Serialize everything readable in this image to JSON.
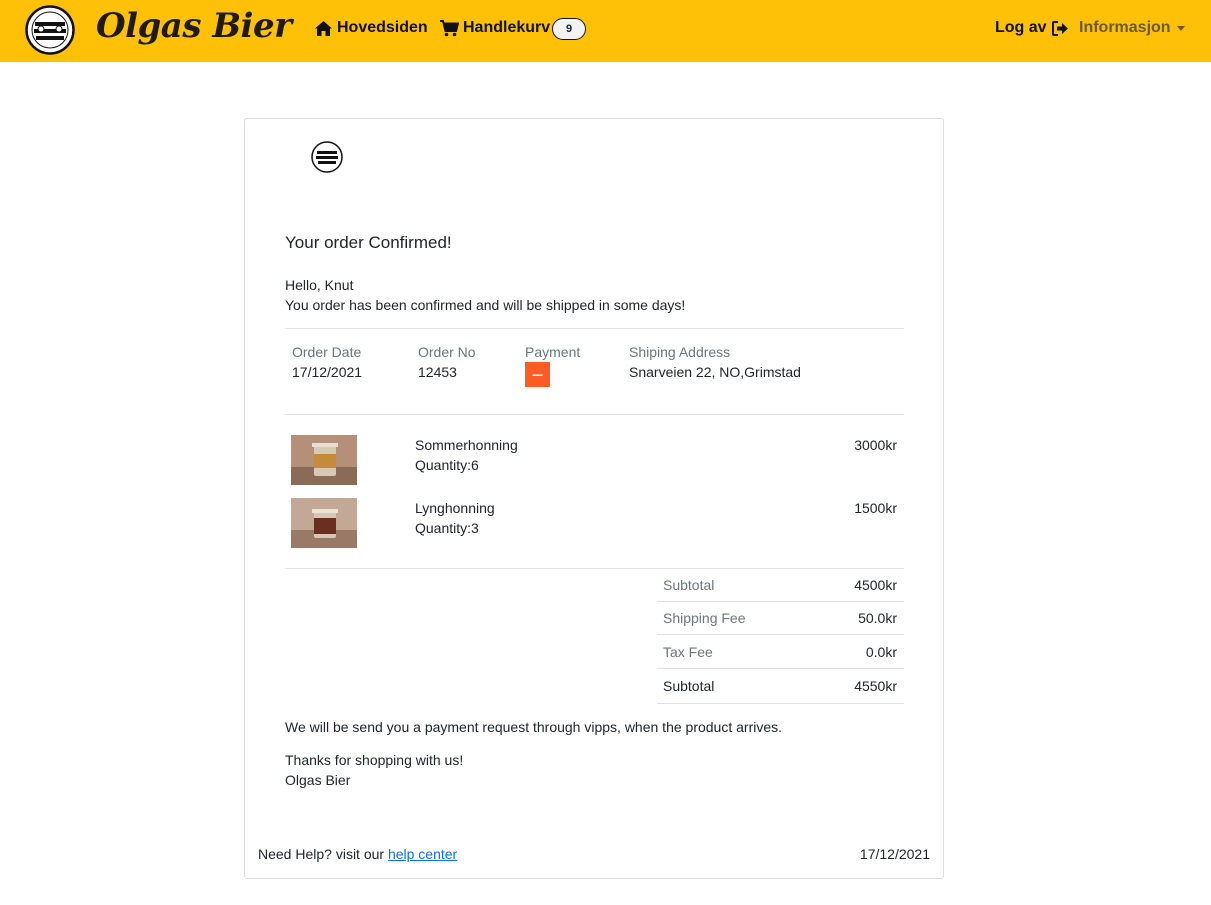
{
  "nav": {
    "brand": "Olgas Bier",
    "home": "Hovedsiden",
    "cart": "Handlekurv",
    "cart_count": "9",
    "logout": "Log av",
    "info": "Informasjon"
  },
  "order": {
    "title": "Your order Confirmed!",
    "greeting": "Hello, Knut",
    "message": "You order has been confirmed and will be shipped in some days!",
    "details": {
      "order_date_label": "Order Date",
      "order_date": "17/12/2021",
      "order_no_label": "Order No",
      "order_no": "12453",
      "payment_label": "Payment",
      "address_label": "Shiping Address",
      "address": "Snarveien 22, NO,Grimstad"
    },
    "items": [
      {
        "name": "Sommerhonning",
        "quantity": "Quantity:6",
        "price": "3000kr"
      },
      {
        "name": "Lynghonning",
        "quantity": "Quantity:3",
        "price": "1500kr"
      }
    ],
    "totals": {
      "subtotal_label": "Subtotal",
      "subtotal": "4500kr",
      "shipping_label": "Shipping Fee",
      "shipping": "50.0kr",
      "tax_label": "Tax Fee",
      "tax": "0.0kr",
      "total_label": "Subtotal",
      "total": "4550kr"
    },
    "payment_note": "We will be send you a payment request through vipps, when the product arrives.",
    "thanks": "Thanks for shopping with us!",
    "signature": "Olgas Bier"
  },
  "footer": {
    "help_text": "Need Help? visit our",
    "help_link": "help center",
    "date": "17/12/2021"
  },
  "colors": {
    "navbar": "#ffc107",
    "vipps": "#ff5b24",
    "link": "#0d6efd"
  }
}
